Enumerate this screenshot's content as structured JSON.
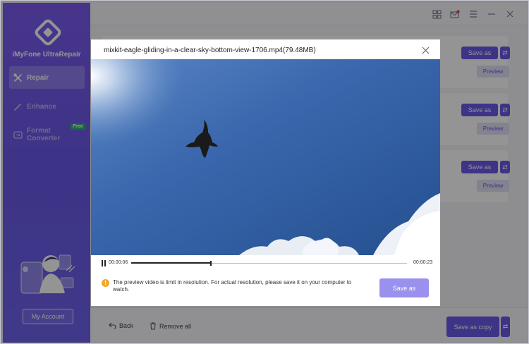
{
  "app": {
    "name": "iMyFone UltraRepair",
    "brand_color": "#6a5ae8"
  },
  "sidebar": {
    "items": [
      {
        "label": "Repair",
        "icon": "repair-tools-icon",
        "active": true
      },
      {
        "label": "Enhance",
        "icon": "magic-wand-icon",
        "active": false
      },
      {
        "label": "Format Converter",
        "icon": "converter-icon",
        "active": false,
        "badge": "Free"
      }
    ],
    "account_label": "My Account"
  },
  "topbar": {
    "icons": [
      "grid-icon",
      "mail-icon",
      "menu-icon",
      "minimize-icon",
      "close-icon"
    ]
  },
  "cards": [
    {
      "save_label": "Save as",
      "preview_label": "Preview"
    },
    {
      "save_label": "Save as",
      "preview_label": "Preview"
    },
    {
      "save_label": "Save as",
      "preview_label": "Preview"
    }
  ],
  "bottombar": {
    "back_label": "Back",
    "remove_all_label": "Remove all",
    "save_copy_label": "Save as copy"
  },
  "modal": {
    "title": "mixkit-eagle-gliding-in-a-clear-sky-bottom-view-1706.mp4(79.48MB)",
    "current_time": "00:00:06",
    "total_time": "00:00:23",
    "progress": 0.29,
    "notice": "The preview video is limit in resolution. For actual resolution, please save it on your computer to watch.",
    "save_label": "Save as",
    "swap_glyph": "⇄"
  }
}
